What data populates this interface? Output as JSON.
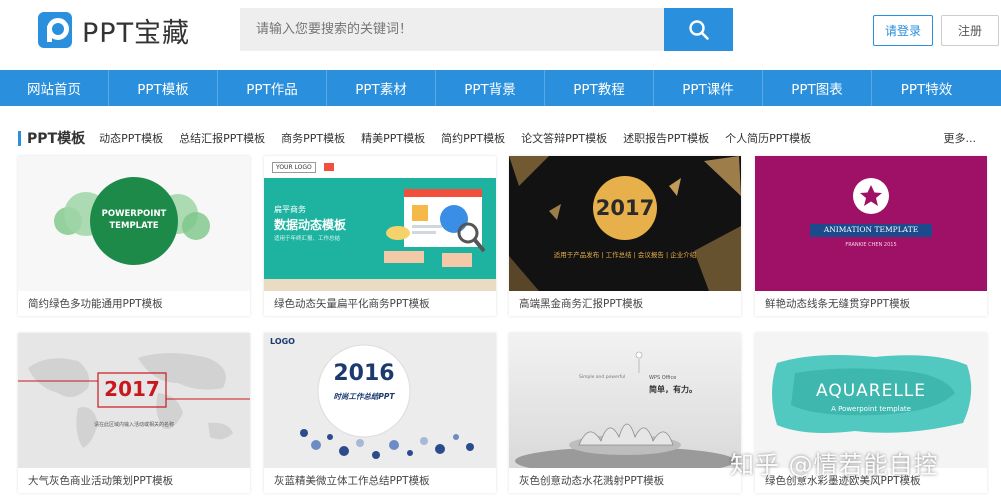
{
  "header": {
    "logo_text": "PPT宝藏",
    "search_placeholder": "请输入您要搜索的关键词！",
    "login_label": "请登录",
    "register_label": "注册"
  },
  "nav": {
    "items": [
      "网站首页",
      "PPT模板",
      "PPT作品",
      "PPT素材",
      "PPT背景",
      "PPT教程",
      "PPT课件",
      "PPT图表",
      "PPT特效"
    ]
  },
  "section": {
    "title": "PPT模板",
    "links": [
      "动态PPT模板",
      "总结汇报PPT模板",
      "商务PPT模板",
      "精美PPT模板",
      "简约PPT模板",
      "论文答辩PPT模板",
      "述职报告PPT模板",
      "个人简历PPT模板"
    ],
    "more": "更多..."
  },
  "cards": [
    {
      "caption": "简约绿色多功能通用PPT模板",
      "thumb": {
        "line1": "POWERPOINT",
        "line2": "TEMPLATE"
      }
    },
    {
      "caption": "绿色动态矢量扁平化商务PPT模板",
      "thumb": {
        "logo": "YOUR LOGO",
        "small": "扁平商务",
        "big": "数据动态模板",
        "sub": "适用于年终汇报、工作总结"
      }
    },
    {
      "caption": "高端黑金商务汇报PPT模板",
      "thumb": {
        "year": "2017",
        "sub": "适用于产品发布 | 工作总结 | 会议报告 | 企业介绍"
      }
    },
    {
      "caption": "鲜艳动态线条无缝贯穿PPT模板",
      "thumb": {
        "title": "ANIMATION TEMPLATE",
        "sub": "FRANKIE CHEN 2015"
      }
    },
    {
      "caption": "大气灰色商业活动策划PPT模板",
      "thumb": {
        "year": "2017",
        "sub": "请在此区域内输入活动或相关的名称"
      }
    },
    {
      "caption": "灰蓝精美微立体工作总结PPT模板",
      "thumb": {
        "logo": "LOGO",
        "year": "2016",
        "sub": "时尚工作总结PPT"
      }
    },
    {
      "caption": "灰色创意动态水花溅射PPT模板",
      "thumb": {
        "tag": "WPS Office",
        "small": "Simple and powerful",
        "cn": "简单，有力。"
      }
    },
    {
      "caption": "绿色创意水彩墨迹欧美风PPT模板",
      "thumb": {
        "title": "AQUARELLE",
        "sub": "A Powerpoint template"
      }
    }
  ],
  "watermark": "知乎 @情若能自控",
  "colors": {
    "accent": "#2a8fdc",
    "nav": "#2a8fdc"
  }
}
